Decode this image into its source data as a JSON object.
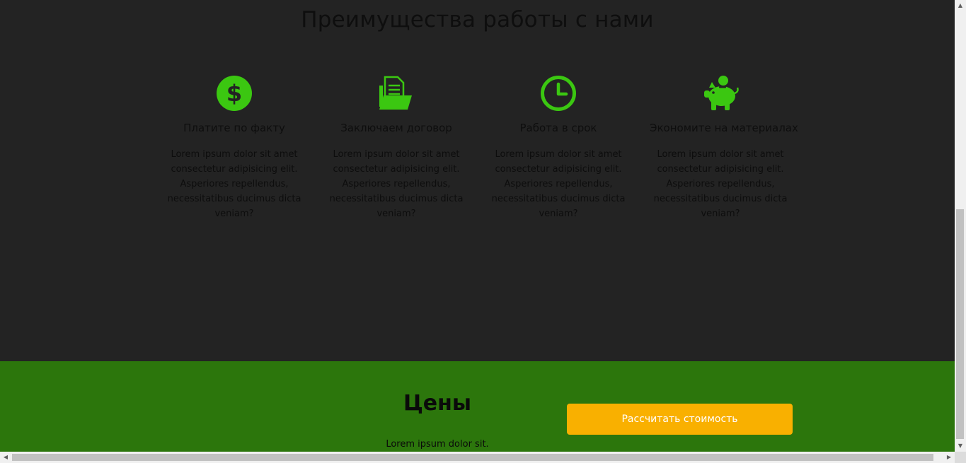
{
  "benefits": {
    "title": "Преимущества работы с нами",
    "items": [
      {
        "icon": "dollar-circle-icon",
        "title": "Платите по факту",
        "text": "Lorem ipsum dolor sit amet consectetur adipisicing elit. Asperiores repellendus, necessitatibus ducimus dicta veniam?"
      },
      {
        "icon": "folder-document-icon",
        "title": "Заключаем договор",
        "text": "Lorem ipsum dolor sit amet consectetur adipisicing elit. Asperiores repellendus, necessitatibus ducimus dicta veniam?"
      },
      {
        "icon": "clock-icon",
        "title": "Работа в срок",
        "text": "Lorem ipsum dolor sit amet consectetur adipisicing elit. Asperiores repellendus, necessitatibus ducimus dicta veniam?"
      },
      {
        "icon": "piggy-bank-icon",
        "title": "Экономите на материалах",
        "text": "Lorem ipsum dolor sit amet consectetur adipisicing elit. Asperiores repellendus, necessitatibus ducimus dicta veniam?"
      }
    ]
  },
  "prices": {
    "title": "Цены",
    "subtitle": "Lorem ipsum dolor sit.",
    "button_label": "Рассчитать стоимость"
  },
  "colors": {
    "accent_green": "#3bc711",
    "section_green": "#2c760c",
    "button_orange": "#f9b000",
    "dark_background": "#232323"
  }
}
